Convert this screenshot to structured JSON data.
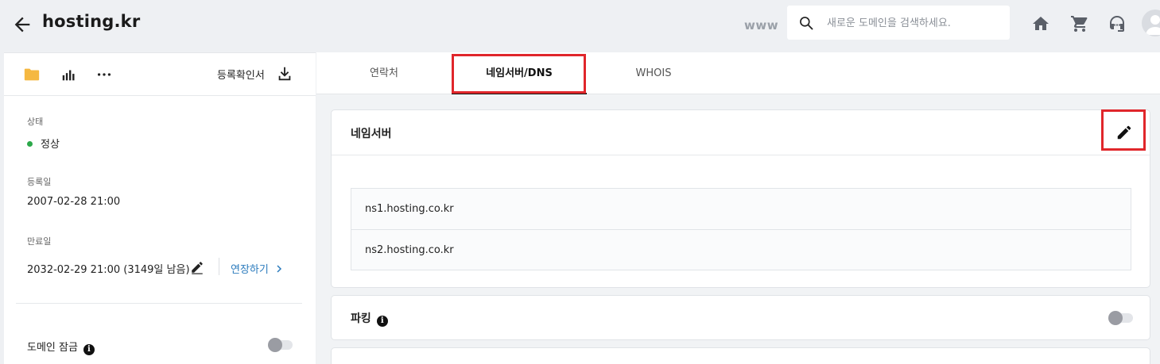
{
  "header": {
    "title": "hosting.kr",
    "www_label": "www",
    "search_placeholder": "새로운 도메인을 검색하세요.",
    "icons": [
      "back-arrow-icon",
      "search-icon",
      "home-icon",
      "cart-icon",
      "support-headset-icon",
      "user-avatar-icon"
    ]
  },
  "left": {
    "toolbar": {
      "icons": [
        "folder-icon",
        "bar-chart-icon",
        "more-icon"
      ],
      "reg_confirm_label": "등록확인서",
      "download_icon": "download-icon"
    },
    "status": {
      "label": "상태",
      "value": "정상",
      "color": "#2ca84a"
    },
    "registered": {
      "label": "등록일",
      "value": "2007-02-28 21:00"
    },
    "expiry": {
      "label": "만료일",
      "value": "2032-02-29 21:00 (3149일 남음)",
      "extend_label": "연장하기"
    },
    "domain_lock": {
      "label": "도메인 잠금",
      "enabled": false
    }
  },
  "tabs": [
    {
      "label": "연락처",
      "active": false
    },
    {
      "label": "네임서버/DNS",
      "active": true
    },
    {
      "label": "WHOIS",
      "active": false
    }
  ],
  "nameserver": {
    "title": "네임서버",
    "servers": [
      "ns1.hosting.co.kr",
      "ns2.hosting.co.kr"
    ]
  },
  "parking": {
    "title": "파킹",
    "enabled": false
  },
  "colors": {
    "highlight": "#e0262b",
    "link": "#2b7bbd",
    "status_ok": "#2ca84a"
  }
}
